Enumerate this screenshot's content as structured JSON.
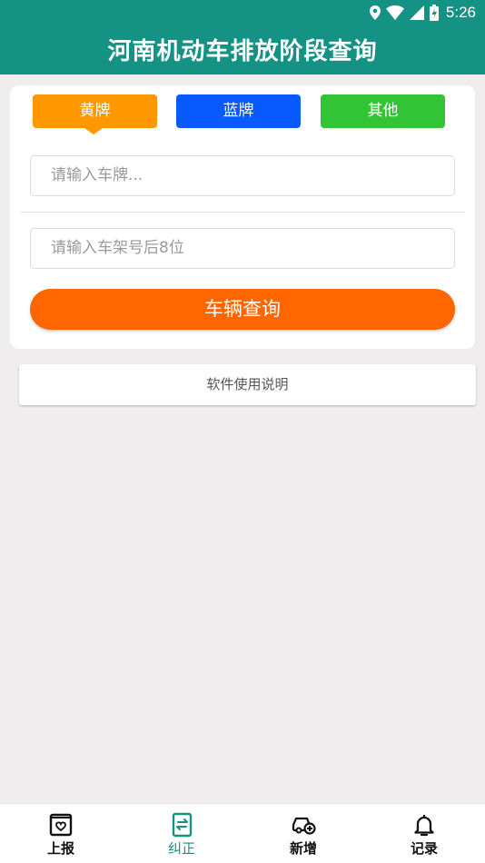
{
  "status_bar": {
    "time": "5:26"
  },
  "header": {
    "title": "河南机动车排放阶段查询"
  },
  "plate_types": [
    {
      "label": "黄牌",
      "color": "#ff9800",
      "selected": true
    },
    {
      "label": "蓝牌",
      "color": "#0a5bff",
      "selected": false
    },
    {
      "label": "其他",
      "color": "#33c435",
      "selected": false
    }
  ],
  "form": {
    "plate_placeholder": "请输入车牌...",
    "vin_placeholder": "请输入车架号后8位",
    "query_label": "车辆查询"
  },
  "help": {
    "label": "软件使用说明"
  },
  "bottom_nav": [
    {
      "label": "上报",
      "icon": "report-icon",
      "active": false
    },
    {
      "label": "纠正",
      "icon": "correct-icon",
      "active": true
    },
    {
      "label": "新增",
      "icon": "add-vehicle-icon",
      "active": false
    },
    {
      "label": "记录",
      "icon": "bell-icon",
      "active": false
    }
  ],
  "colors": {
    "primary": "#149284",
    "query_button": "#ff6600",
    "background": "#efedee"
  }
}
